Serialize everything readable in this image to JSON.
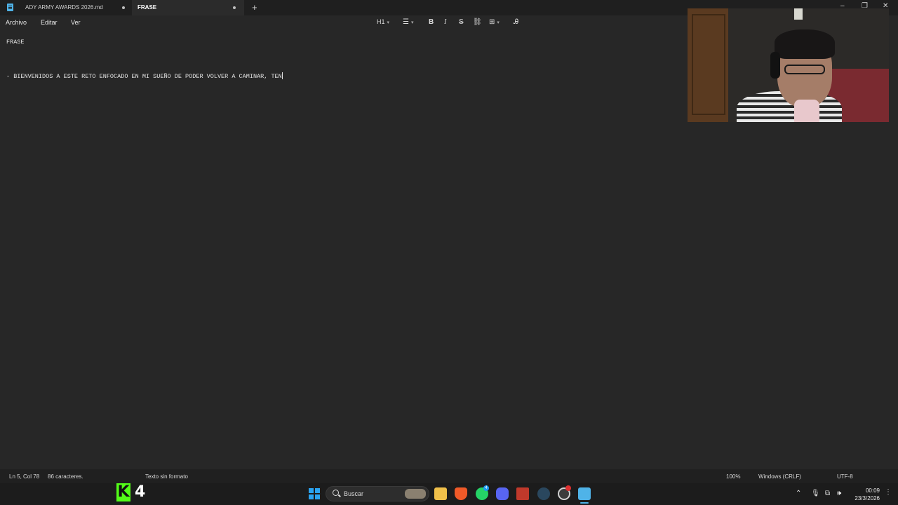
{
  "tabs": [
    {
      "label": "ADY ARMY AWARDS 2026.md",
      "unsaved": true
    },
    {
      "label": "FRASE",
      "unsaved": true
    }
  ],
  "window_controls": {
    "new_tab": "+",
    "minimize": "–",
    "maximize": "❐",
    "close": "✕"
  },
  "menu": {
    "file": "Archivo",
    "edit": "Editar",
    "view": "Ver"
  },
  "toolbar": {
    "heading": "H1",
    "bold": "B",
    "italic": "I",
    "strikethrough": "S"
  },
  "document": {
    "lines": [
      "FRASE",
      "",
      "",
      "- BIENVENIDOS A ESTE RETO ENFOCADO EN MI SUEÑO DE PODER VOLVER A CAMINAR, TEN"
    ]
  },
  "status_bar": {
    "position": "Ln 5, Col 78",
    "char_count": "86 caracteres.",
    "format": "Texto sin formato",
    "zoom": "100%",
    "line_endings": "Windows (CRLF)",
    "encoding": "UTF-8"
  },
  "overlay": {
    "kick_logo": "K",
    "kick_count": "4"
  },
  "taskbar": {
    "search_placeholder": "Buscar",
    "whatsapp_badge": "4",
    "icons": [
      "start-icon",
      "search-icon",
      "folder-icon",
      "brave-icon",
      "whatsapp-icon",
      "discord-icon",
      "voicemeeter-icon",
      "steam-icon",
      "obs-icon",
      "notepad-icon"
    ]
  },
  "system_tray": {
    "time": "00:09",
    "date": "23/3/2026"
  },
  "colors": {
    "accent": "#4fb3e8",
    "kick_green": "#53fc18",
    "background": "#272727"
  }
}
